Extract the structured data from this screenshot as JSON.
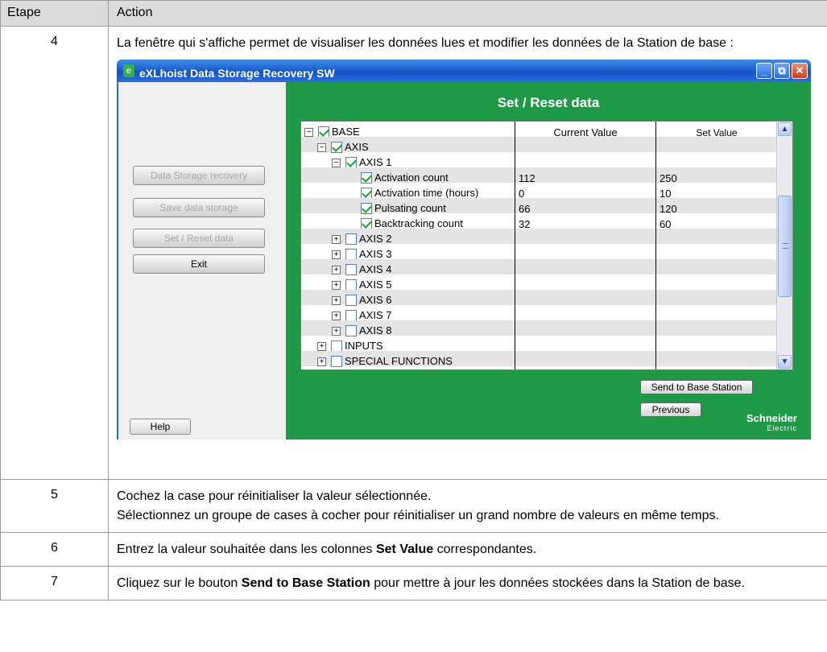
{
  "table": {
    "header": {
      "step": "Etape",
      "action": "Action"
    },
    "step4": {
      "number": "4",
      "text": "La fenêtre qui s'affiche permet de visualiser les données lues et modifier les données de la Station de base :"
    },
    "step5": {
      "number": "5",
      "line1": "Cochez la case pour réinitialiser la valeur sélectionnée.",
      "line2": "Sélectionnez un groupe de cases à cocher pour réinitialiser un grand nombre de valeurs en même temps."
    },
    "step6": {
      "number": "6",
      "pre": "Entrez la valeur souhaitée dans les colonnes ",
      "bold": "Set Value",
      "post": " correspondantes."
    },
    "step7": {
      "number": "7",
      "pre": "Cliquez sur le bouton ",
      "bold": "Send to Base Station",
      "post": " pour mettre à jour les données stockées dans la Station de base."
    }
  },
  "app": {
    "title": "eXLhoist Data Storage Recovery SW",
    "window_buttons": {
      "minimize": "_",
      "restore": "⧉",
      "close": "✕"
    },
    "left_buttons": [
      {
        "label": "Data Storage recovery",
        "enabled": false
      },
      {
        "label": "Save data storage",
        "enabled": false
      },
      {
        "label": "Set / Reset data",
        "enabled": false
      },
      {
        "label": "Exit",
        "enabled": true
      }
    ],
    "help_label": "Help",
    "panel_title": "Set / Reset data",
    "columns": {
      "current": "Current Value",
      "set": "Set Value"
    },
    "tree": [
      {
        "label": "BASE",
        "expander": "minus",
        "checked": true,
        "current": "",
        "set": ""
      },
      {
        "label": "AXIS",
        "expander": "minus",
        "checked": true,
        "current": "",
        "set": ""
      },
      {
        "label": "AXIS 1",
        "expander": "minus",
        "checked": true,
        "current": "",
        "set": ""
      },
      {
        "label": "Activation count",
        "expander": "none",
        "checked": true,
        "current": "112",
        "set": "250"
      },
      {
        "label": "Activation time (hours)",
        "expander": "none",
        "checked": true,
        "current": "0",
        "set": "10"
      },
      {
        "label": "Pulsating count",
        "expander": "none",
        "checked": true,
        "current": "66",
        "set": "120"
      },
      {
        "label": "Backtracking count",
        "expander": "none",
        "checked": true,
        "current": "32",
        "set": "60"
      },
      {
        "label": "AXIS 2",
        "expander": "plus",
        "checked": false,
        "current": "",
        "set": ""
      },
      {
        "label": "AXIS 3",
        "expander": "plus",
        "checked": false,
        "current": "",
        "set": ""
      },
      {
        "label": "AXIS 4",
        "expander": "plus",
        "checked": false,
        "current": "",
        "set": ""
      },
      {
        "label": "AXIS 5",
        "expander": "plus",
        "checked": false,
        "current": "",
        "set": ""
      },
      {
        "label": "AXIS 6",
        "expander": "plus",
        "checked": false,
        "current": "",
        "set": ""
      },
      {
        "label": "AXIS 7",
        "expander": "plus",
        "checked": false,
        "current": "",
        "set": ""
      },
      {
        "label": "AXIS 8",
        "expander": "plus",
        "checked": false,
        "current": "",
        "set": ""
      },
      {
        "label": "INPUTS",
        "expander": "plus",
        "checked": false,
        "current": "",
        "set": ""
      },
      {
        "label": "SPECIAL FUNCTIONS",
        "expander": "plus",
        "checked": false,
        "current": "",
        "set": ""
      }
    ],
    "send_button": "Send to Base Station",
    "previous_button": "Previous",
    "logo": {
      "name": "Schneider",
      "sub": "Electric"
    },
    "colors": {
      "titlebar": "#1e5fd0",
      "panel_green": "#1e9a46",
      "left_bg": "#f0f0f0"
    }
  }
}
